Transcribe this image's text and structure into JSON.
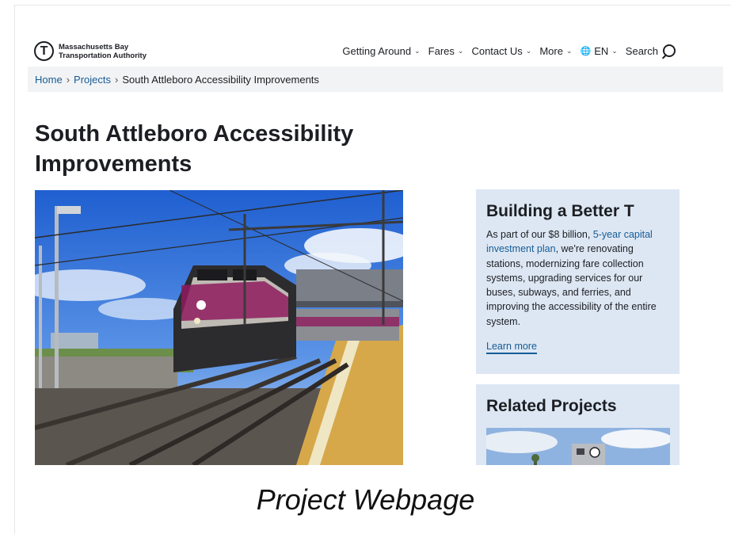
{
  "header": {
    "logo_line1": "Massachusetts Bay",
    "logo_line2": "Transportation Authority",
    "logo_letter": "T",
    "nav": [
      {
        "label": "Getting Around"
      },
      {
        "label": "Fares"
      },
      {
        "label": "Contact Us"
      },
      {
        "label": "More"
      },
      {
        "label": "EN"
      },
      {
        "label": "Search"
      }
    ]
  },
  "breadcrumb": {
    "home": "Home",
    "projects": "Projects",
    "current": "South Attleboro Accessibility Improvements",
    "separator": "›"
  },
  "page": {
    "title": "South Attleboro Accessibility Improvements"
  },
  "sidebar": {
    "card": {
      "title": "Building a Better T",
      "text_before": "As part of our $8 billion, ",
      "link_text": "5-year capital investment plan",
      "text_after": ", we're renovating stations, modernizing fare collection systems, upgrading services for our buses, subways, and ferries, and improving the accessibility of the entire system.",
      "learn_more": "Learn more"
    },
    "related": {
      "title": "Related Projects"
    }
  },
  "caption": "Project Webpage",
  "colors": {
    "link": "#165c96",
    "card_bg": "#dde7f3",
    "breadcrumb_bg": "#f2f3f4",
    "train_magenta": "#8e1b5e"
  }
}
